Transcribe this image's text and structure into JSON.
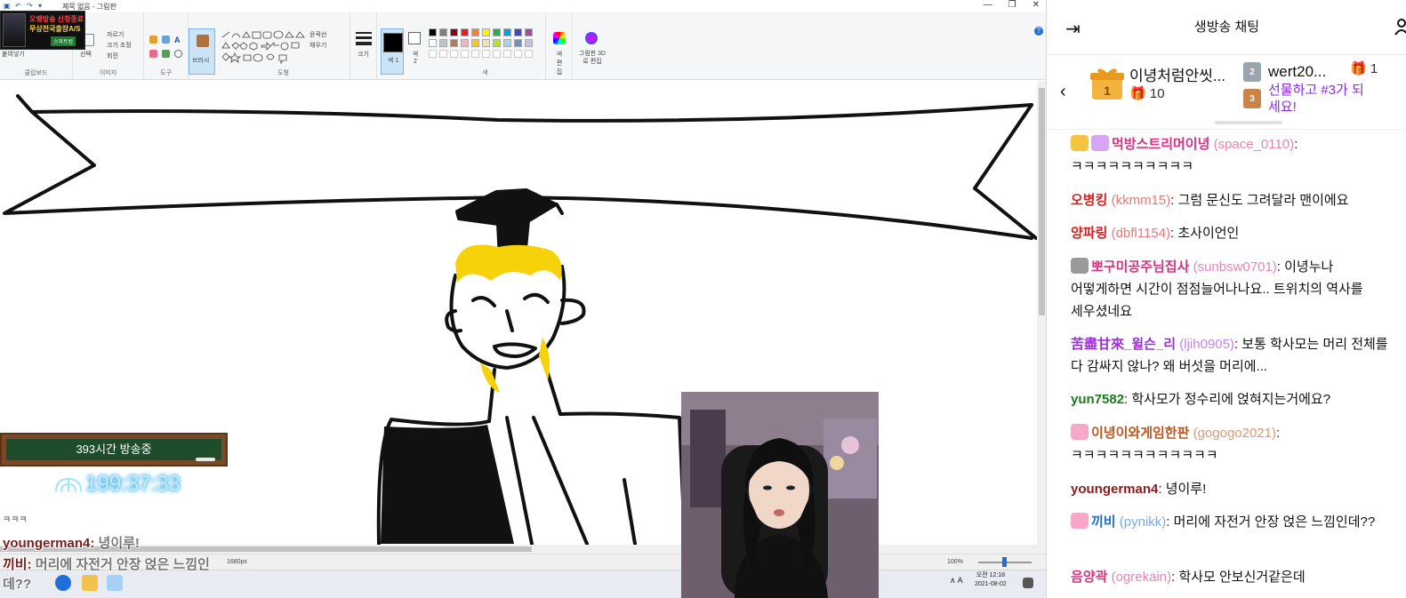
{
  "paint": {
    "window_title": "제목 없음 - 그림판",
    "window_controls": [
      "—",
      "❐",
      "✕"
    ],
    "ribbon": {
      "clipboard": {
        "paste": "붙여넣기",
        "label": "클립보드"
      },
      "image": {
        "select": "선택",
        "crop": "자르기",
        "resize": "크기 조정",
        "rotate": "회전",
        "label": "이미지"
      },
      "tools": {
        "label": "도구"
      },
      "brushes": {
        "label": "브러시"
      },
      "shapes": {
        "outline": "윤곽선",
        "fill": "채우기",
        "label": "도형"
      },
      "size": {
        "label": "크기"
      },
      "color1": "색 1",
      "color2": "색 2",
      "colors": {
        "label": "색",
        "edit": "색 편집",
        "paint3d": "그림판 3D로 편집"
      },
      "palette_row1": [
        "#000000",
        "#7f7f7f",
        "#880015",
        "#ed1c24",
        "#ff7f27",
        "#fff200",
        "#22b14c",
        "#00a2e8",
        "#3f48cc",
        "#a349a4"
      ],
      "palette_row2": [
        "#ffffff",
        "#c3c3c3",
        "#b97a57",
        "#ffaec9",
        "#ffc90e",
        "#efe4b0",
        "#b5e61d",
        "#99d9ea",
        "#7092be",
        "#c8bfe7"
      ]
    },
    "status": {
      "dimensions": "1680px",
      "zoom": "100%"
    },
    "taskbar": {
      "time": "오전 12:18",
      "date": "2021-08-02",
      "tray": "∧  A"
    }
  },
  "overlay": {
    "promo": {
      "line1": "오뱅방송 신청종료",
      "line2": "무상전국출장A/S",
      "line3": "스마트컴"
    },
    "board_text": "393시간 방송중",
    "timer": "199:37:33",
    "chat_lines": [
      {
        "nick": "",
        "msg": "ㅋㅋㅋ"
      },
      {
        "nick": "youngerman4:",
        "msg": " 녕이루!"
      },
      {
        "nick": "끼비:",
        "msg": " 머리에 자전거 안장 얹은 느낌인"
      },
      {
        "nick": "",
        "msg": "데??"
      }
    ]
  },
  "chat": {
    "header_title": "생방송 채팅",
    "gifts": {
      "rank1_name": "이녕처럼안씻...",
      "rank1_count": "10",
      "rank2_name": "wert20...",
      "rank2_count": "1",
      "cta": "선물하고 #3가 되세요!"
    },
    "messages": [
      {
        "name": "먹방스트리머이녕",
        "id": "(space_0110)",
        "text": ": ㅋㅋㅋㅋㅋㅋㅋㅋㅋㅋ",
        "color": "#d63384"
      },
      {
        "name": "오병킹",
        "id": "(kkmm15)",
        "text": ": 그럼 문신도 그려달라 맨이에요",
        "color": "#d62020"
      },
      {
        "name": "양파링",
        "id": "(dbfl1154)",
        "text": ": 초사이언인",
        "color": "#d62020"
      },
      {
        "name": "뽀구미공주님집사",
        "id": "(sunbsw0701)",
        "text": ": 이녕누나 어떻게하면 시간이 점점늘어나나요.. 트위치의 역사를 세우셨네요",
        "color": "#d63384"
      },
      {
        "name": "苦盡甘來_윌슨_리",
        "id": "(ljih0905)",
        "text": ": 보통 학사모는 머리 전체를 다 감싸지 않나? 왜 버섯을 머리에...",
        "color": "#9b30d9"
      },
      {
        "name": "yun7582",
        "id": "",
        "text": ": 학사모가 정수리에 얹혀지는거에요?",
        "color": "#1f7a1f"
      },
      {
        "name": "이녕이와게임한판",
        "id": "(gogogo2021)",
        "text": ": ㅋㅋㅋㅋㅋㅋㅋㅋㅋㅋㅋㅋ",
        "color": "#c0561f"
      },
      {
        "name": "youngerman4",
        "id": "",
        "text": ": 녕이루!",
        "color": "#8b1c1c"
      },
      {
        "name": "끼비",
        "id": "(pynikk)",
        "text": ": 머리에 자전거 안장 얹은 느낌인데??",
        "color": "#1f6fd6"
      },
      {
        "name": "음양곽",
        "id": "(ogrekain)",
        "text": ": 학사모 안보신거같은데",
        "color": "#d63384"
      }
    ]
  }
}
